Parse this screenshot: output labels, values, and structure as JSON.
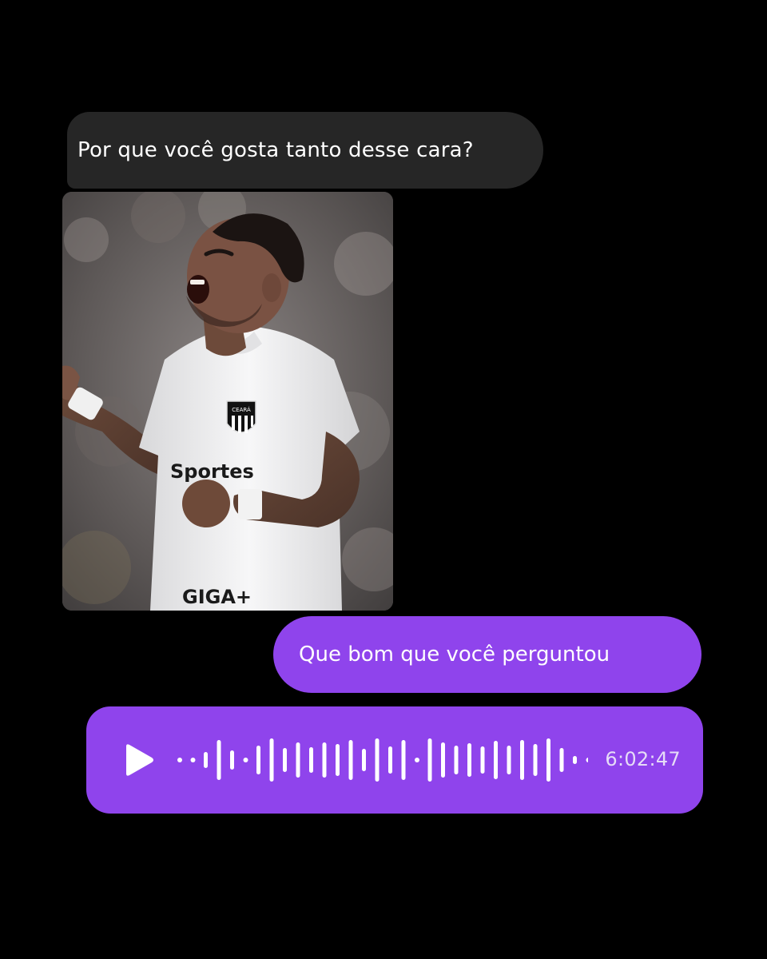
{
  "conversation": {
    "incoming_message": "Por que você gosta tanto desse cara?",
    "photo": {
      "type": "photo",
      "subject": "soccer-player-celebrating",
      "jersey_crest_text": "CEARÁ",
      "jersey_sponsor_text": "Sportes",
      "jersey_sponsor_text_2": "GIGA+"
    },
    "outgoing_message": "Que bom que você perguntou",
    "voice_message": {
      "play_icon": "play-icon",
      "duration": "6:02:47"
    }
  },
  "colors": {
    "background": "#000000",
    "incoming_bubble": "#262626",
    "outgoing_bubble": "#8f44ec",
    "text": "#ffffff"
  }
}
